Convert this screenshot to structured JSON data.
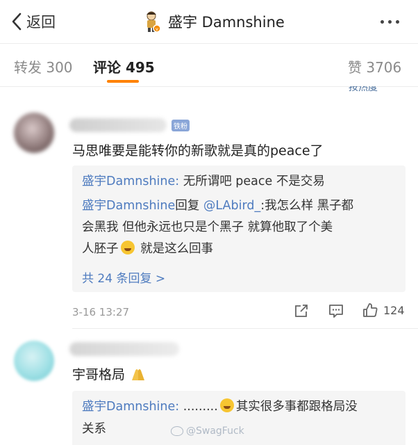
{
  "nav": {
    "back_label": "返回",
    "title": "盛宇 Damnshine"
  },
  "tabs": [
    {
      "label": "转发 300",
      "active": false
    },
    {
      "label": "评论 495",
      "active": true
    },
    {
      "label": "赞 3706",
      "active": false
    }
  ],
  "sort_label": "按热度",
  "colors": {
    "accent": "#ff8200",
    "link": "#4e7bbf"
  },
  "comments": [
    {
      "user_badge": "铁粉",
      "text": "马思唯要是能转你的新歌就是真的peace了",
      "replies": [
        {
          "name": "盛宇Damnshine:",
          "text": " 无所谓吧  peace 不是交易"
        },
        {
          "name": "盛宇Damnshine",
          "text_a": "回复",
          "mention": "@LAbird_",
          "text_b": ":我怎么样 黑子都",
          "text_c": "会黑我 但他永远也只是个黑子  就算他取了个美",
          "text_d": "人胚子",
          "text_e": " 就是这么回事"
        }
      ],
      "more_replies": "共 24 条回复 >",
      "time": "3-16 13:27",
      "likes": "124"
    },
    {
      "text": "宇哥格局",
      "replies": [
        {
          "name": "盛宇Damnshine:",
          "text_a": " .........",
          "text_b": "其实很多事都跟格局没",
          "text_c": "关系"
        }
      ]
    }
  ],
  "watermark": "@SwagFuck"
}
